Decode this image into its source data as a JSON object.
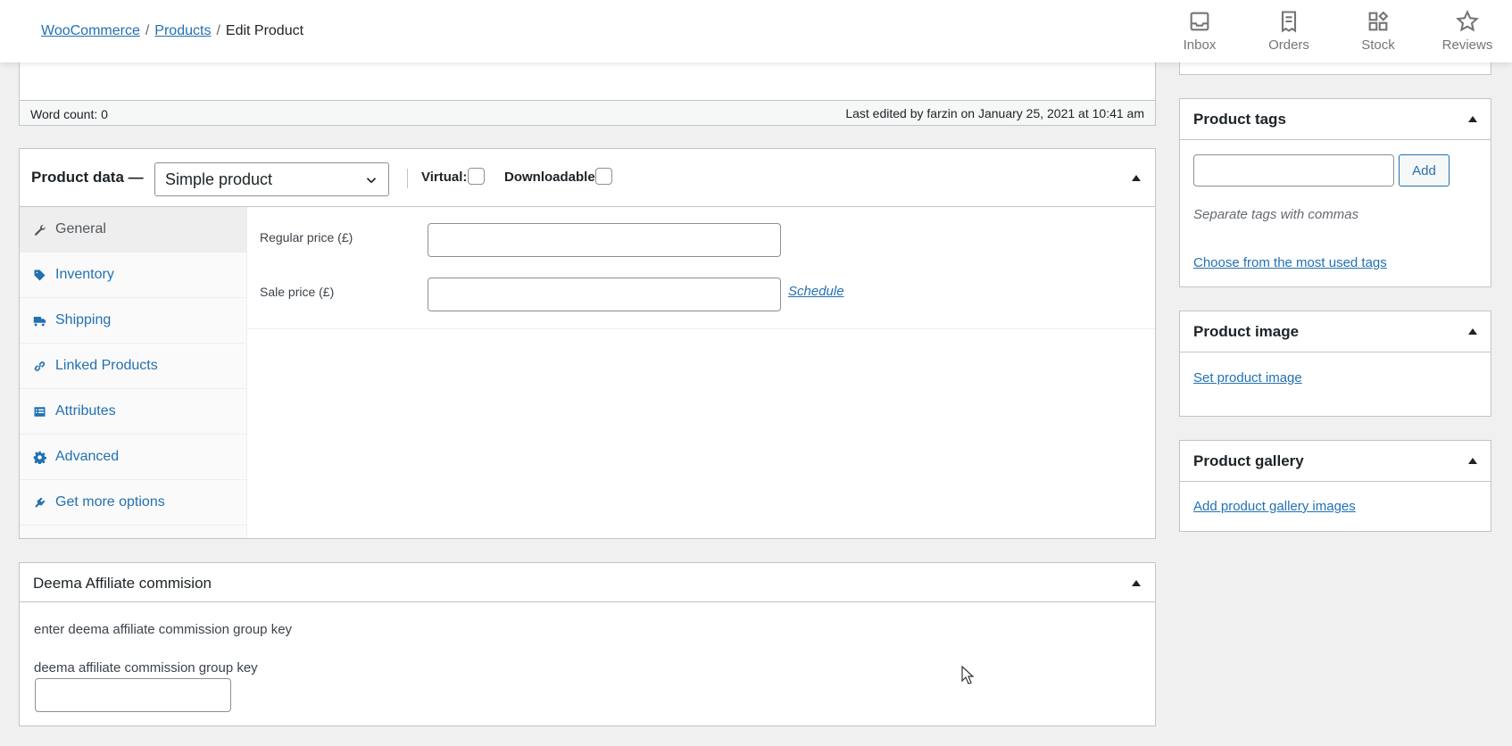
{
  "breadcrumb": {
    "root": "WooCommerce",
    "section": "Products",
    "current": "Edit Product",
    "separator": "/"
  },
  "activity_bar": {
    "items": [
      {
        "label": "Inbox",
        "icon": "inbox-icon"
      },
      {
        "label": "Orders",
        "icon": "orders-icon"
      },
      {
        "label": "Stock",
        "icon": "stock-icon"
      },
      {
        "label": "Reviews",
        "icon": "star-icon"
      }
    ]
  },
  "editor_status": {
    "word_count": "Word count: 0",
    "last_edited": "Last edited by farzin on January 25, 2021 at 10:41 am"
  },
  "product_data": {
    "title": "Product data —",
    "type_selected": "Simple product",
    "virtual_label": "Virtual:",
    "downloadable_label": "Downloadable:",
    "virtual_checked": false,
    "downloadable_checked": false,
    "tabs": [
      {
        "label": "General",
        "icon": "wrench-icon",
        "active": true
      },
      {
        "label": "Inventory",
        "icon": "tag-icon",
        "active": false
      },
      {
        "label": "Shipping",
        "icon": "truck-icon",
        "active": false
      },
      {
        "label": "Linked Products",
        "icon": "link-icon",
        "active": false
      },
      {
        "label": "Attributes",
        "icon": "list-icon",
        "active": false
      },
      {
        "label": "Advanced",
        "icon": "gear-icon",
        "active": false
      },
      {
        "label": "Get more options",
        "icon": "plugin-icon",
        "active": false
      }
    ],
    "regular_price_label": "Regular price (£)",
    "regular_price_value": "",
    "sale_price_label": "Sale price (£)",
    "sale_price_value": "",
    "schedule_link": "Schedule"
  },
  "deema": {
    "title": "Deema Affiliate commision",
    "description": "enter deema affiliate commission group key",
    "field_label": "deema affiliate commission group key",
    "field_value": ""
  },
  "sidebar": {
    "tags": {
      "title": "Product tags",
      "add_button": "Add",
      "input_value": "",
      "hint": "Separate tags with commas",
      "most_used_link": "Choose from the most used tags"
    },
    "image": {
      "title": "Product image",
      "link": "Set product image"
    },
    "gallery": {
      "title": "Product gallery",
      "link": "Add product gallery images"
    }
  },
  "colors": {
    "link": "#2271b1",
    "text": "#1d2327",
    "background": "#f0f0f1",
    "border": "#c3c4c7"
  }
}
